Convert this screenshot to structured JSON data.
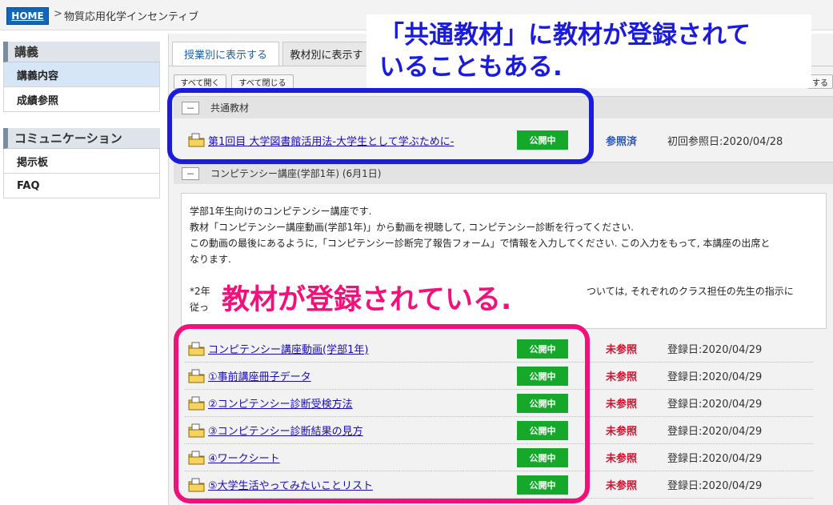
{
  "breadcrumb": {
    "home": "HOME",
    "separator": ">",
    "current": "物質応用化学インセンティブ"
  },
  "sidebar": {
    "sections": [
      {
        "title": "講義",
        "items": [
          {
            "label": "講義内容",
            "active": true
          },
          {
            "label": "成績参照",
            "active": false
          }
        ]
      },
      {
        "title": "コミュニケーション",
        "items": [
          {
            "label": "掲示板",
            "active": false
          },
          {
            "label": "FAQ",
            "active": false
          }
        ]
      }
    ]
  },
  "tabs": [
    {
      "label": "授業別に表示する"
    },
    {
      "label": "教材別に表示す"
    }
  ],
  "buttons": {
    "expand_all": "すべて開く",
    "collapse_all": "すべて閉じる",
    "right_fragment": "する"
  },
  "common_section": {
    "toggle": "－",
    "title": "共通教材",
    "row": {
      "title": "第1回目 大学図書館活用法-大学生として学ぶために-",
      "badge": "公開中",
      "status": "参照済",
      "date": "初回参照日:2020/04/28"
    }
  },
  "competency_section": {
    "toggle": "－",
    "title": "コンピテンシー講座(学部1年) (6月1日)",
    "description": {
      "line1": "学部1年生向けのコンピテンシー講座です.",
      "line2": "教材「コンピテンシー講座動画(学部1年)」から動画を視聴して, コンピテンシー診断を行ってください.",
      "line3": "この動画の最後にあるように,「コンピテンシー診断完了報告フォーム」で情報を入力してください. この入力をもって, 本講座の出席と",
      "line4": "なります.",
      "line5_left": "*2年",
      "line5_right": "ついては, それぞれのクラス担任の先生の指示に",
      "line6": "従っ"
    },
    "rows": [
      {
        "title": "コンピテンシー講座動画(学部1年)",
        "badge": "公開中",
        "status": "未参照",
        "date": "登録日:2020/04/29"
      },
      {
        "title": "①事前講座冊子データ",
        "badge": "公開中",
        "status": "未参照",
        "date": "登録日:2020/04/29"
      },
      {
        "title": "②コンピテンシー診断受検方法",
        "badge": "公開中",
        "status": "未参照",
        "date": "登録日:2020/04/29"
      },
      {
        "title": "③コンピテンシー診断結果の見方",
        "badge": "公開中",
        "status": "未参照",
        "date": "登録日:2020/04/29"
      },
      {
        "title": "④ワークシート",
        "badge": "公開中",
        "status": "未参照",
        "date": "登録日:2020/04/29"
      },
      {
        "title": "⑤大学生活やってみたいことリスト",
        "badge": "公開中",
        "status": "未参照",
        "date": "登録日:2020/04/29"
      }
    ]
  },
  "annotations": {
    "blue_line1": "「共通教材」に教材が登録されて",
    "blue_line2": "いることもある.",
    "pink": "教材が登録されている."
  },
  "colors": {
    "accent_blue": "#1166bb",
    "annotation_blue": "#1b1bdc",
    "annotation_pink": "#f2117a",
    "badge_green": "#16a82b",
    "unref_red": "#d0122f"
  }
}
